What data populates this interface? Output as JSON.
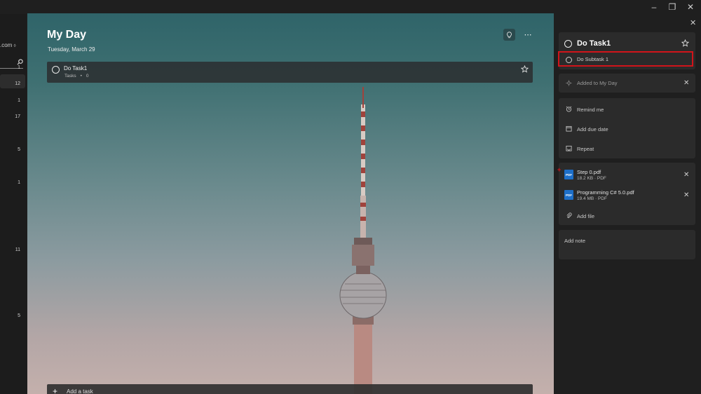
{
  "window": {
    "minimize_icon": "minimize-icon",
    "restore_icon": "restore-icon",
    "close_icon": "close-icon"
  },
  "sidebar": {
    "account_fragment": ".com",
    "account_caret": "◊",
    "counts": [
      "1",
      "12",
      "1",
      "17",
      "5",
      "1",
      "11",
      "5"
    ]
  },
  "main": {
    "title": "My Day",
    "subtitle": "Tuesday, March 29",
    "task": {
      "title": "Do Task1",
      "list": "Tasks",
      "dot": "•",
      "subcount": "0"
    },
    "add_task_label": "Add a task"
  },
  "detail": {
    "task_title": "Do Task1",
    "subtask_label": "Do Subtask 1",
    "my_day_label": "Added to My Day",
    "remind_label": "Remind me",
    "due_label": "Add due date",
    "repeat_label": "Repeat",
    "files": [
      {
        "name": "Step 0.pdf",
        "meta": "18.2 KB · PDF",
        "type": "PDF"
      },
      {
        "name": "Programming C# 5.0.pdf",
        "meta": "19.4 MB · PDF",
        "type": "PDF"
      }
    ],
    "add_file_label": "Add file",
    "note_placeholder": "Add note"
  },
  "colors": {
    "accent_highlight": "#d1141a",
    "pdf_blue": "#1d6fc9",
    "pane_bg": "#1f1f1f",
    "card_bg": "#2b2b2b"
  }
}
